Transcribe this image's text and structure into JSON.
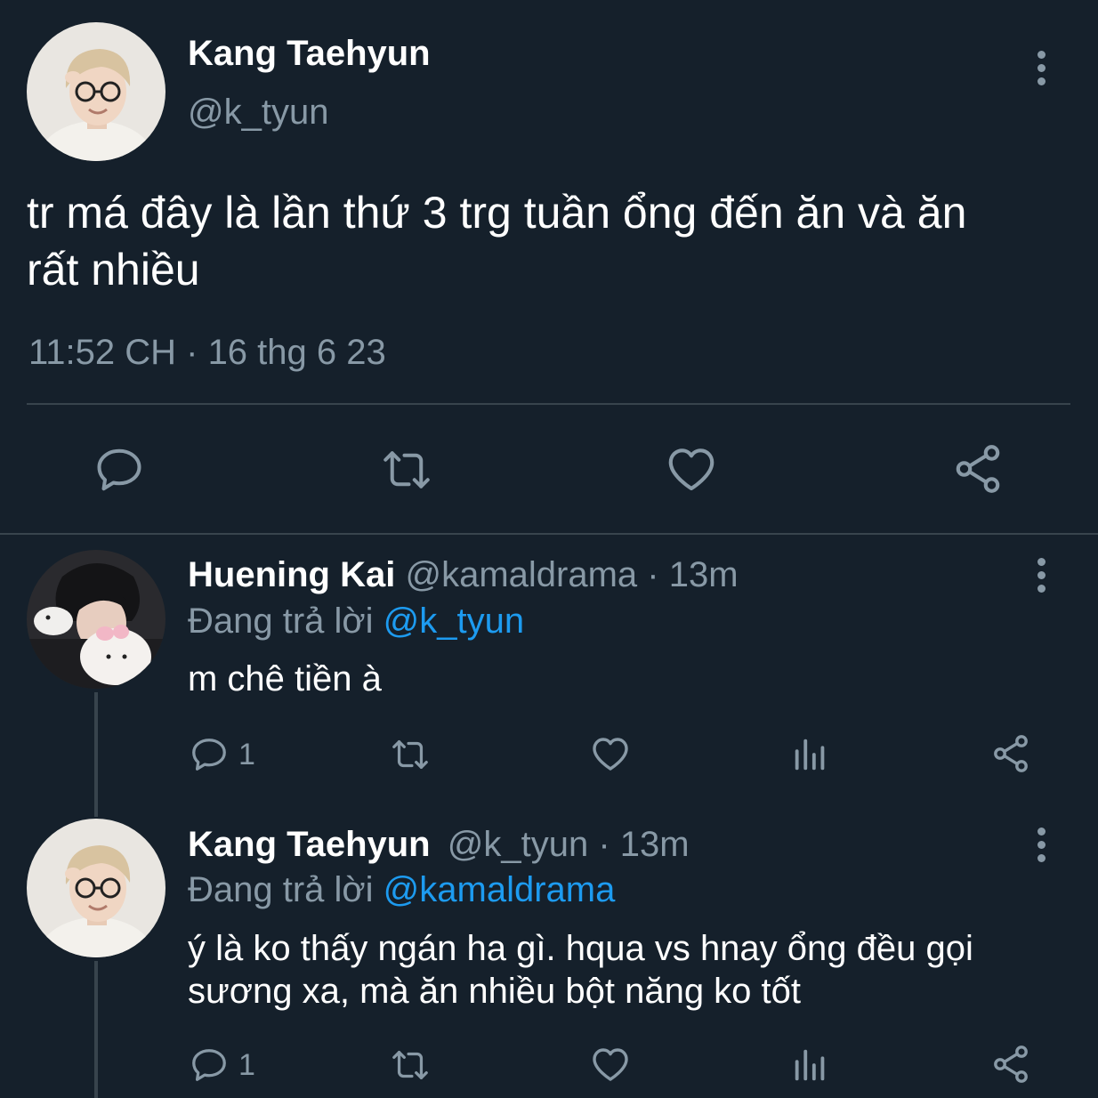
{
  "main_tweet": {
    "display_name": "Kang Taehyun",
    "handle": "@k_tyun",
    "text_line1": "tr má đây là lần thứ 3 trg tuần ổng đến ăn và ăn",
    "text_line2": "rất nhiều",
    "timestamp": "11:52 CH · 16 thg 6 23",
    "actions": [
      "reply-icon",
      "retweet-icon",
      "like-icon",
      "share-icon"
    ]
  },
  "replies": [
    {
      "display_name": "Huening Kai",
      "handle": "@kamaldrama",
      "time": "· 13m",
      "replying_label": "Đang trả lời",
      "replying_to": "@k_tyun",
      "text_line1": "m chê tiền à",
      "text_line2": "",
      "reply_count": "1"
    },
    {
      "display_name": "Kang Taehyun",
      "handle": "@k_tyun",
      "time": "· 13m",
      "replying_label": "Đang trả lời",
      "replying_to": "@kamaldrama",
      "text_line1": "ý là ko thấy ngán ha gì. hqua vs hnay ổng đều gọi",
      "text_line2": "sương xa, mà ăn nhiều bột năng ko tốt",
      "reply_count": "1"
    }
  ],
  "colors": {
    "background": "#15202b",
    "muted": "#8899a6",
    "link": "#1d9bf0",
    "divider": "#38444d"
  }
}
